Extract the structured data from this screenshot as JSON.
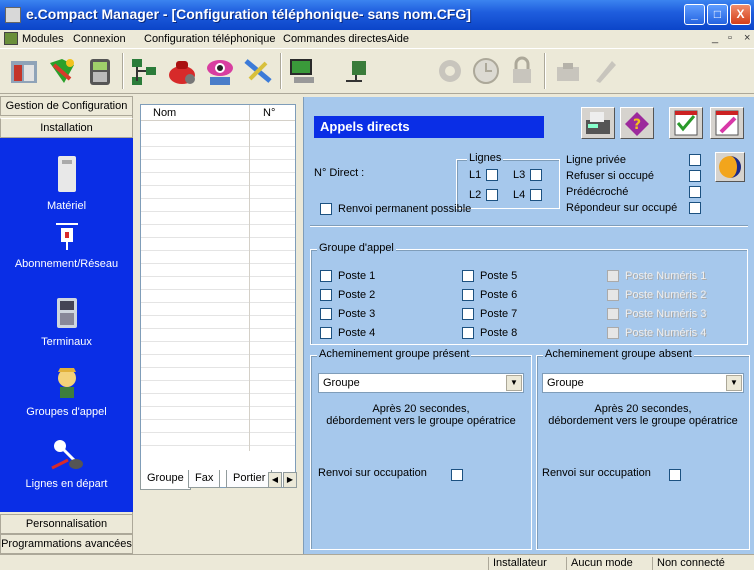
{
  "window": {
    "title": "e.Compact Manager - [Configuration téléphonique- sans nom.CFG]"
  },
  "menu": {
    "items": [
      "Modules",
      "Connexion",
      "Configuration téléphonique",
      "Commandes directes",
      "Aide"
    ]
  },
  "toolbar": {
    "icons": [
      "modules-icon",
      "network-config-icon",
      "telephone-icon",
      "tree-config-icon",
      "phone-settings-icon",
      "monitor-view-icon",
      "toolbox-icon",
      "pc-connect-icon",
      "transfer-icon",
      "network-disabled-icon",
      "clock-disabled-icon",
      "lock-disabled-icon",
      "archive-disabled-icon",
      "pen-disabled-icon"
    ]
  },
  "leftnav": {
    "top_header": "Gestion de Configuration",
    "section": "Installation",
    "items": [
      {
        "label": "Matériel",
        "icon": "hardware-icon"
      },
      {
        "label": "Abonnement/Réseau",
        "icon": "network-plug-icon"
      },
      {
        "label": "Terminaux",
        "icon": "terminal-phone-icon"
      },
      {
        "label": "Groupes d'appel",
        "icon": "call-group-icon"
      },
      {
        "label": "Lignes en départ",
        "icon": "outgoing-line-icon"
      }
    ],
    "bottom": [
      "Personnalisation",
      "Programmations avancées"
    ]
  },
  "list": {
    "headers": [
      "Nom",
      "N°"
    ],
    "tabs": [
      "Groupe",
      "Fax",
      "Portier"
    ]
  },
  "main": {
    "title": "Appels directs",
    "direct_label": "N° Direct :",
    "lignes_legend": "Lignes",
    "lines": [
      "L1",
      "L3",
      "L2",
      "L4"
    ],
    "options": [
      "Ligne privée",
      "Refuser si occupé",
      "Prédécroché",
      "Répondeur sur occupé"
    ],
    "renvoi_permanent": "Renvoi permanent possible",
    "groupe_legend": "Groupe d'appel",
    "postes": [
      "Poste 1",
      "Poste 2",
      "Poste 3",
      "Poste 4",
      "Poste 5",
      "Poste 6",
      "Poste 7",
      "Poste 8"
    ],
    "postes_numeris": [
      "Poste Numéris 1",
      "Poste Numéris 2",
      "Poste Numéris 3",
      "Poste Numéris 4"
    ],
    "present": {
      "legend": "Acheminement groupe présent",
      "select": "Groupe",
      "overflow_line1": "Après 20 secondes,",
      "overflow_line2": "débordement vers le groupe opératrice",
      "renvoi": "Renvoi sur occupation"
    },
    "absent": {
      "legend": "Acheminement groupe absent",
      "select": "Groupe",
      "overflow_line1": "Après 20 secondes,",
      "overflow_line2": "débordement vers le groupe opératrice",
      "renvoi": "Renvoi sur occupation"
    }
  },
  "status": {
    "user": "Installateur",
    "mode": "Aucun mode",
    "connection": "Non connecté"
  }
}
